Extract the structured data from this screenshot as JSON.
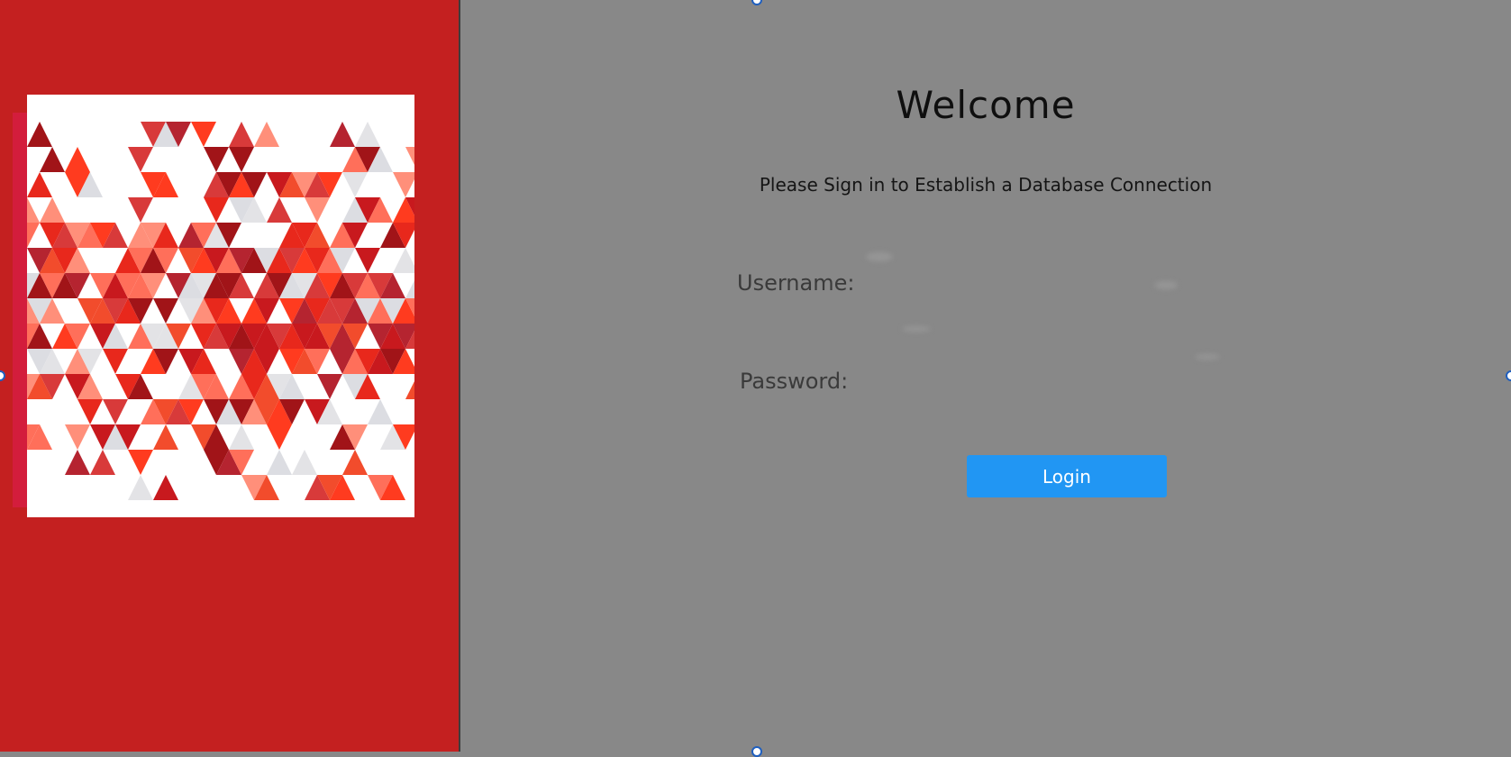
{
  "login": {
    "title": "Welcome",
    "subtitle": "Please Sign in to Establish a Database Connection",
    "username_label": "Username:",
    "password_label": "Password:",
    "username_value": "",
    "password_value": "",
    "login_label": "Login"
  },
  "colors": {
    "left_panel": "#c42020",
    "right_panel": "#888888",
    "divider": "#3d3d3d",
    "button": "#2196f3",
    "button_text": "#ffffff",
    "handle_border": "#1f5fbf"
  },
  "icons": {
    "pattern": "geometric-triangle-mosaic-image"
  }
}
